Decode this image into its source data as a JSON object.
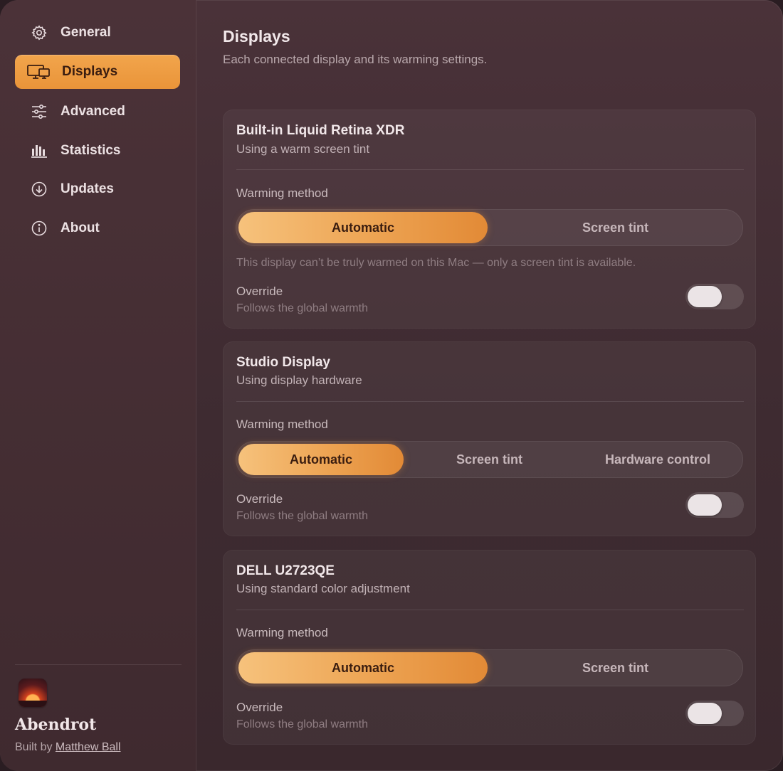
{
  "sidebar": {
    "items": [
      {
        "label": "General",
        "icon": "gear-icon"
      },
      {
        "label": "Displays",
        "icon": "displays-icon",
        "active": true
      },
      {
        "label": "Advanced",
        "icon": "sliders-icon"
      },
      {
        "label": "Statistics",
        "icon": "bar-chart-icon"
      },
      {
        "label": "Updates",
        "icon": "download-circle-icon"
      },
      {
        "label": "About",
        "icon": "info-circle-icon"
      }
    ],
    "app_name": "Abendrot",
    "built_by_prefix": "Built by ",
    "author": "Matthew Ball"
  },
  "main": {
    "title": "Displays",
    "subtitle": "Each connected display and its warming settings."
  },
  "displays": [
    {
      "name": "Built-in Liquid Retina XDR",
      "status": "Using a warm screen tint",
      "method_label": "Warming method",
      "options": [
        "Automatic",
        "Screen tint"
      ],
      "selected": "Automatic",
      "hint": "This display can’t be truly warmed on this Mac — only a screen tint is available.",
      "override_label": "Override",
      "override_sub": "Follows the global warmth",
      "override_on": false
    },
    {
      "name": "Studio Display",
      "status": "Using display hardware",
      "method_label": "Warming method",
      "options": [
        "Automatic",
        "Screen tint",
        "Hardware control"
      ],
      "selected": "Automatic",
      "override_label": "Override",
      "override_sub": "Follows the global warmth",
      "override_on": false
    },
    {
      "name": "DELL U2723QE",
      "status": "Using standard color adjustment",
      "method_label": "Warming method",
      "options": [
        "Automatic",
        "Screen tint"
      ],
      "selected": "Automatic",
      "override_label": "Override",
      "override_sub": "Follows the global warmth",
      "override_on": false
    }
  ],
  "colors": {
    "accent": "#ef9d45",
    "background": "#45303a",
    "sidebar": "#4a3238"
  }
}
